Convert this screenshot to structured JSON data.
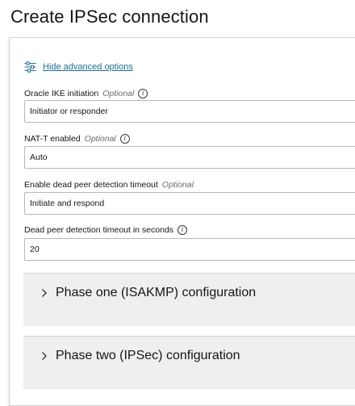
{
  "header": {
    "title": "Create IPSec connection"
  },
  "advanced": {
    "toggle_label": "Hide advanced options",
    "icon": "sliders-icon"
  },
  "fields": {
    "ike_initiation": {
      "label": "Oracle IKE initiation",
      "optional": "Optional",
      "value": "Initiator or responder"
    },
    "nat_t": {
      "label": "NAT-T enabled",
      "optional": "Optional",
      "value": "Auto"
    },
    "dpd_enable": {
      "label": "Enable dead peer detection timeout",
      "optional": "Optional",
      "value": "Initiate and respond"
    },
    "dpd_timeout": {
      "label": "Dead peer detection timeout in seconds",
      "value": "20"
    }
  },
  "sections": {
    "phase_one": {
      "title": "Phase one (ISAKMP) configuration"
    },
    "phase_two": {
      "title": "Phase two (IPSec) configuration"
    }
  },
  "colors": {
    "link": "#1c6f8c",
    "section_bg": "#f1efed",
    "border": "#bcb6b1"
  }
}
